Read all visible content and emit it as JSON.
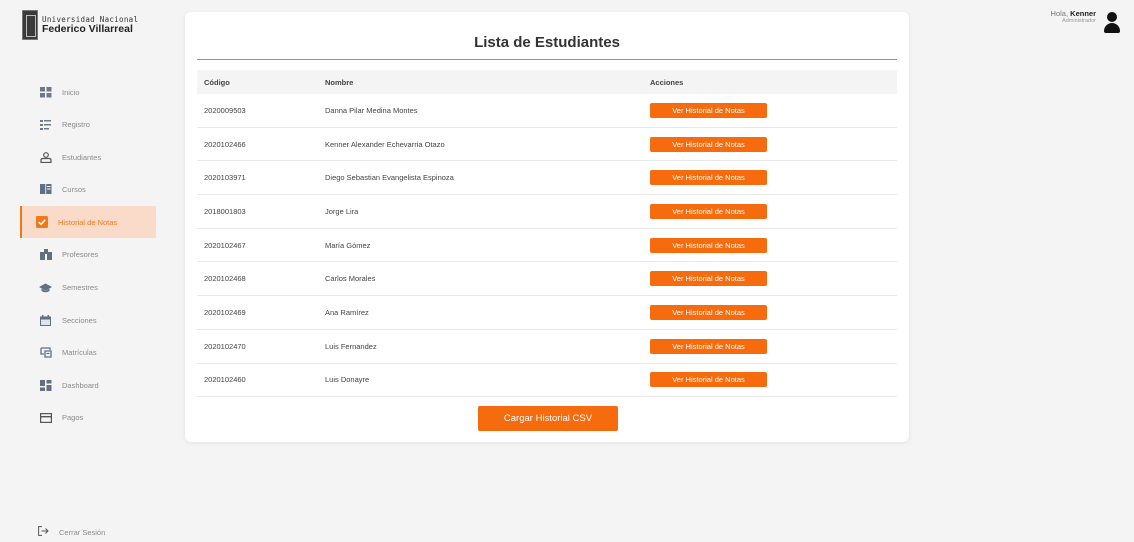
{
  "logo": {
    "line1": "Universidad Nacional",
    "line2": "Federico Villarreal"
  },
  "sidebar": {
    "items": [
      {
        "label": "Inicio",
        "icon": "grid-icon"
      },
      {
        "label": "Registro",
        "icon": "register-icon"
      },
      {
        "label": "Estudiantes",
        "icon": "user-icon"
      },
      {
        "label": "Cursos",
        "icon": "book-icon"
      },
      {
        "label": "Historial de Notas",
        "icon": "check-square-icon",
        "active": true
      },
      {
        "label": "Profesores",
        "icon": "teacher-icon"
      },
      {
        "label": "Semestres",
        "icon": "graduation-cap-icon"
      },
      {
        "label": "Secciones",
        "icon": "calendar-icon"
      },
      {
        "label": "Matrículas",
        "icon": "enroll-icon"
      },
      {
        "label": "Dashboard",
        "icon": "dashboard-icon"
      },
      {
        "label": "Pagos",
        "icon": "card-icon"
      }
    ],
    "logout": "Cerrar Sesión"
  },
  "user": {
    "greeting": "Hola,",
    "name": "Kenner",
    "role": "Administrador"
  },
  "main": {
    "title": "Lista de Estudiantes",
    "columns": [
      "Código",
      "Nombre",
      "Acciones"
    ],
    "action_label": "Ver Historial de Notas",
    "rows": [
      {
        "codigo": "2020009503",
        "nombre": "Danna Pilar Medina Montes"
      },
      {
        "codigo": "2020102466",
        "nombre": "Kenner Alexander Echevarria Otazo"
      },
      {
        "codigo": "2020103971",
        "nombre": "Diego Sebastian Evangelista Espinoza"
      },
      {
        "codigo": "2018001803",
        "nombre": "Jorge Lira"
      },
      {
        "codigo": "2020102467",
        "nombre": "María Gómez"
      },
      {
        "codigo": "2020102468",
        "nombre": "Carlos Morales"
      },
      {
        "codigo": "2020102469",
        "nombre": "Ana Ramírez"
      },
      {
        "codigo": "2020102470",
        "nombre": "Luis Fernandez"
      },
      {
        "codigo": "2020102460",
        "nombre": "Luis Donayre"
      }
    ],
    "upload_label": "Cargar Historial CSV"
  },
  "colors": {
    "accent": "#f66b0e",
    "active_bg": "#fadbc9"
  }
}
